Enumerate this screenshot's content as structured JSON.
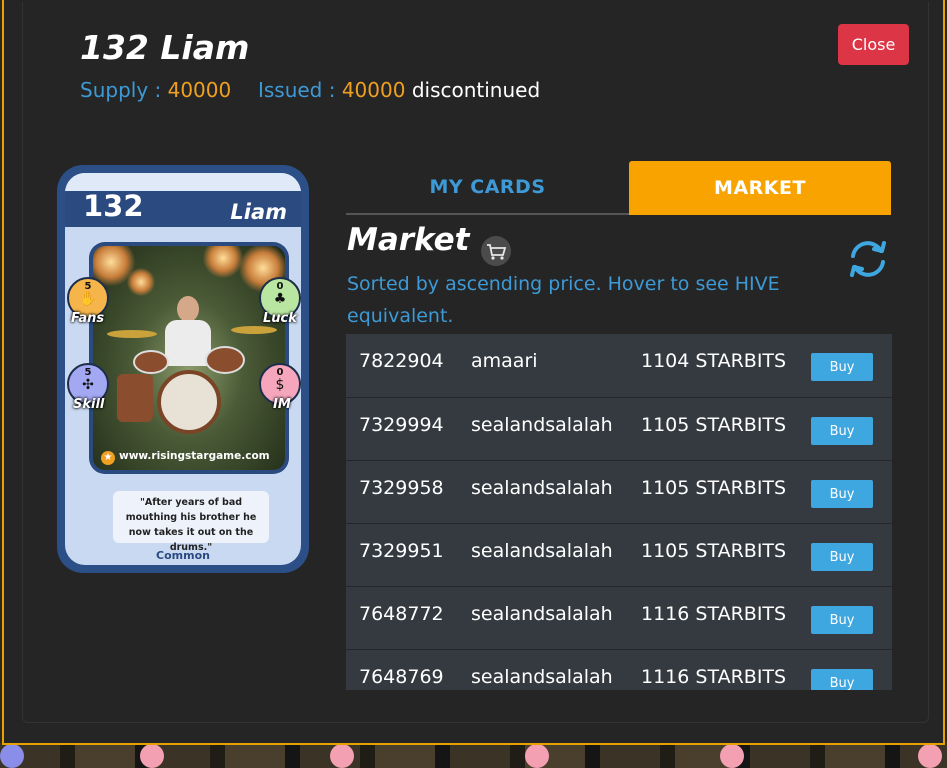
{
  "modal": {
    "title": "132 Liam",
    "supply_label": "Supply :",
    "supply_value": "40000",
    "issued_label": "Issued :",
    "issued_value": "40000",
    "status": "discontinued",
    "close_label": "Close"
  },
  "card": {
    "number": "132",
    "name": "Liam",
    "stats": {
      "fans": {
        "label": "Fans",
        "value": "5"
      },
      "luck": {
        "label": "Luck",
        "value": "0"
      },
      "skill": {
        "label": "Skill",
        "value": "5"
      },
      "im": {
        "label": "IM",
        "value": "0"
      }
    },
    "website": "www.risingstargame.com",
    "quote": "\"After years of bad mouthing his brother he now takes it out on the drums.\"",
    "rarity": "Common"
  },
  "tabs": [
    {
      "label": "MY CARDS",
      "active": false
    },
    {
      "label": "MARKET",
      "active": true
    }
  ],
  "market": {
    "title": "Market",
    "sort_note": "Sorted by ascending price. Hover to see HIVE equivalent.",
    "buy_label": "Buy",
    "listings": [
      {
        "id": "7822904",
        "seller": "amaari",
        "price": "1104 STARBITS"
      },
      {
        "id": "7329994",
        "seller": "sealandsalalah",
        "price": "1105 STARBITS"
      },
      {
        "id": "7329958",
        "seller": "sealandsalalah",
        "price": "1105 STARBITS"
      },
      {
        "id": "7329951",
        "seller": "sealandsalalah",
        "price": "1105 STARBITS"
      },
      {
        "id": "7648772",
        "seller": "sealandsalalah",
        "price": "1116 STARBITS"
      },
      {
        "id": "7648769",
        "seller": "sealandsalalah",
        "price": "1116 STARBITS"
      }
    ]
  },
  "colors": {
    "accent_orange": "#f9a300",
    "link_blue": "#3d9ad6",
    "close_red": "#dc3545",
    "buy_blue": "#3fa7e0"
  },
  "icons": [
    "cart-icon",
    "refresh-icon",
    "star-icon",
    "fans-icon",
    "luck-icon",
    "skill-icon",
    "im-icon"
  ]
}
